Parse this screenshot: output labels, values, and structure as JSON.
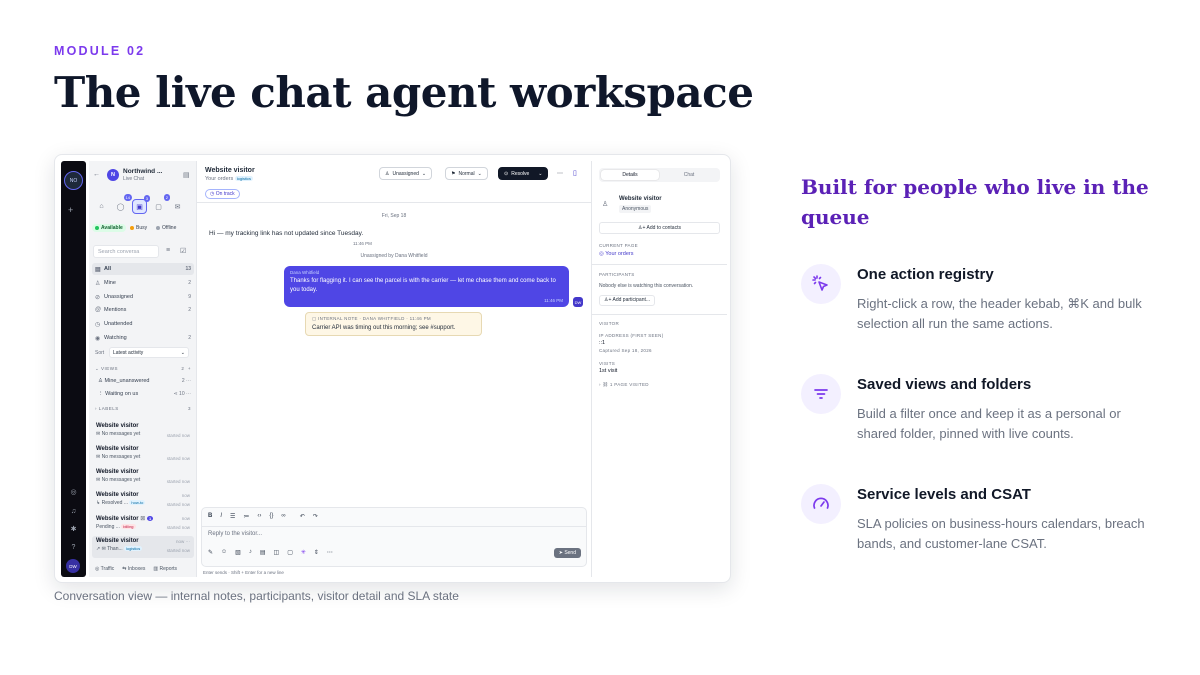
{
  "slide": {
    "kicker": "MODULE 02",
    "title": "The live chat agent workspace",
    "caption": "Conversation view — internal notes, participants, visitor detail and SLA state"
  },
  "features": {
    "heading": "Built for people who live in the queue",
    "items": [
      {
        "icon": "cursor-click-icon",
        "title": "One action registry",
        "body": "Right-click a row, the header kebab, ⌘K and bulk selection all run the same actions."
      },
      {
        "icon": "filter-icon",
        "title": "Saved views and folders",
        "body": "Build a filter once and keep it as a personal or shared folder, pinned with live counts."
      },
      {
        "icon": "gauge-icon",
        "title": "Service levels and CSAT",
        "body": "SLA policies on business-hours calendars, breach bands, and customer-lane CSAT."
      }
    ]
  },
  "app": {
    "rail": {
      "workspace": "NO",
      "user": "DW"
    },
    "sidebar": {
      "org_name": "Northwind ...",
      "org_initial": "N",
      "org_sub": "Live Chat",
      "quick_badges": [
        "14",
        "3",
        "2"
      ],
      "status": [
        "Available",
        "Busy",
        "Offline"
      ],
      "status_colors": [
        "#22c55e",
        "#f59e0b",
        "#9ca3af"
      ],
      "search_placeholder": "Search conversa",
      "filters": [
        {
          "label": "All",
          "count": "13"
        },
        {
          "label": "Mine",
          "count": "2"
        },
        {
          "label": "Unassigned",
          "count": "9"
        },
        {
          "label": "Mentions",
          "count": "2"
        },
        {
          "label": "Unattended",
          "count": ""
        },
        {
          "label": "Watching",
          "count": "2"
        }
      ],
      "sort_label": "Sort",
      "sort_value": "Latest activity",
      "views_label": "VIEWS",
      "views_count": "2",
      "views": [
        {
          "label": "Mine_unanswered",
          "count": "2"
        },
        {
          "label": "Waiting on us",
          "count": "10"
        }
      ],
      "labels_label": "LABELS",
      "labels_count": "3",
      "conversations": [
        {
          "name": "Website visitor",
          "preview": "No messages yet",
          "time": "",
          "status": "started now",
          "tag": ""
        },
        {
          "name": "Website visitor",
          "preview": "No messages yet",
          "time": "",
          "status": "started now",
          "tag": ""
        },
        {
          "name": "Website visitor",
          "preview": "No messages yet",
          "time": "",
          "status": "started now",
          "tag": ""
        },
        {
          "name": "Website visitor",
          "preview": "Resolved ...",
          "time": "now",
          "status": "started now",
          "tag": "how-to"
        },
        {
          "name": "Website visitor",
          "preview": "Pending ...",
          "time": "now",
          "status": "started now",
          "tag": "billing"
        },
        {
          "name": "Website visitor",
          "preview": "Than...",
          "time": "now",
          "status": "started now",
          "tag": "logistics"
        }
      ],
      "footer": [
        "Traffic",
        "Inboxes",
        "Reports"
      ]
    },
    "header": {
      "name": "Website visitor",
      "sub": "Your orders",
      "tag": "logistics",
      "assignee": "Unassigned",
      "priority": "Normal",
      "resolve": "Resolve",
      "sla": "On track"
    },
    "thread": {
      "date": "Fri, Sep 18",
      "visitor_msg": "Hi — my tracking link has not updated since Tuesday.",
      "visitor_time": "11:46 PM",
      "system": "Unassigned by Dana Whitfield",
      "agent_name": "Dana Whitfield",
      "agent_msg": "Thanks for flagging it. I can see the parcel is with the carrier — let me chase them and come back to you today.",
      "agent_time": "11:46 PM",
      "agent_initials": "DW",
      "note_header": "INTERNAL NOTE · DANA WHITFIELD · 11:46 PM",
      "note_body": "Carrier API was timing out this morning; see #support."
    },
    "composer": {
      "placeholder": "Reply to the visitor...",
      "send": "Send",
      "hint": "Enter sends · Shift + Enter for a new line"
    },
    "details": {
      "tabs": [
        "Details",
        "Chat"
      ],
      "visitor_name": "Website visitor",
      "visitor_status": "Anonymous",
      "add_contacts": "Add to contacts",
      "current_page_label": "CURRENT PAGE",
      "current_page": "Your orders",
      "participants_label": "PARTICIPANTS",
      "participants_text": "Nobody else is watching this conversation.",
      "add_participant": "Add participant...",
      "visitor_label": "VISITOR",
      "ip_label": "IP ADDRESS (FIRST SEEN)",
      "ip_value": "::1",
      "captured": "Captured Sep 18, 2026",
      "visits_label": "VISITS",
      "visits_value": "1st visit",
      "pages_visited": "1 PAGE VISITED"
    }
  }
}
